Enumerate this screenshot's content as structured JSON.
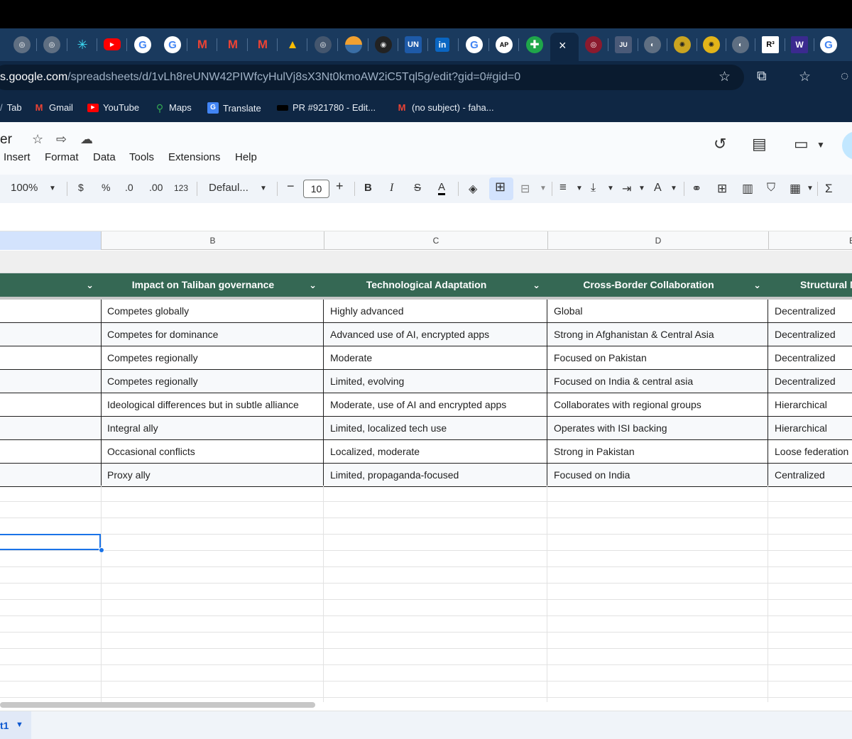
{
  "browser": {
    "active_tab_close": "×",
    "url_host": "s.google.com",
    "url_path": "/spreadsheets/d/1vLh8reUNW42PIWfcyHulVj8sX3Nt0kmoAW2iC5Tql5g/edit?gid=0#gid=0",
    "bookmarks": [
      {
        "label": "Tab"
      },
      {
        "label": "Gmail"
      },
      {
        "label": "YouTube"
      },
      {
        "label": "Maps"
      },
      {
        "label": "Translate"
      },
      {
        "label": "PR #921780 - Edit..."
      },
      {
        "label": "(no subject) - faha..."
      }
    ],
    "tab_badges": {
      "un": "UN",
      "linkedin": "in",
      "ap": "AP",
      "r": "R³",
      "w": "W"
    }
  },
  "sheets": {
    "title_fragment": "er",
    "menu": [
      "Insert",
      "Format",
      "Data",
      "Tools",
      "Extensions",
      "Help"
    ],
    "toolbar": {
      "zoom": "100%",
      "currency": "$",
      "percent": "%",
      "decimal_decrease": ".0",
      "decimal_increase": ".00",
      "format_number": "123",
      "font": "Defaul...",
      "font_size": "10",
      "bold": "B",
      "italic": "I",
      "strike": "S",
      "text_color": "A",
      "sum": "Σ"
    },
    "column_letters": [
      "B",
      "C",
      "D",
      "E"
    ],
    "headers": [
      "Impact on Taliban governance",
      "Technological Adaptation",
      "Cross-Border Collaboration",
      "Structural N"
    ],
    "rows": [
      {
        "b": "Competes globally",
        "c": "Highly advanced",
        "d": "Global",
        "e": "Decentralized"
      },
      {
        "b": "Competes for dominance",
        "c": "Advanced use of AI, encrypted apps",
        "d": "Strong in Afghanistan & Central Asia",
        "e": "Decentralized"
      },
      {
        "b": "Competes regionally",
        "c": "Moderate",
        "d": "Focused on Pakistan",
        "e": "Decentralized"
      },
      {
        "b": "Competes regionally",
        "c": "Limited, evolving",
        "d": "Focused on India & central asia",
        "e": "Decentralized"
      },
      {
        "b": "Ideological differences but in subtle alliance",
        "c": "Moderate, use of AI and encrypted apps",
        "d": "Collaborates with regional groups",
        "e": "Hierarchical"
      },
      {
        "b": "Integral ally",
        "c": "Limited, localized tech use",
        "d": "Operates with ISI backing",
        "e": "Hierarchical"
      },
      {
        "b": "Occasional conflicts",
        "c": "Localized, moderate",
        "d": "Strong in Pakistan",
        "e": "Loose federation"
      },
      {
        "b": "Proxy ally",
        "c": "Limited, propaganda-focused",
        "d": "Focused on India",
        "e": "Centralized"
      }
    ],
    "sheet_tab": "t1",
    "colors": {
      "header_green": "#356854",
      "selection_blue": "#1a73e8"
    }
  }
}
